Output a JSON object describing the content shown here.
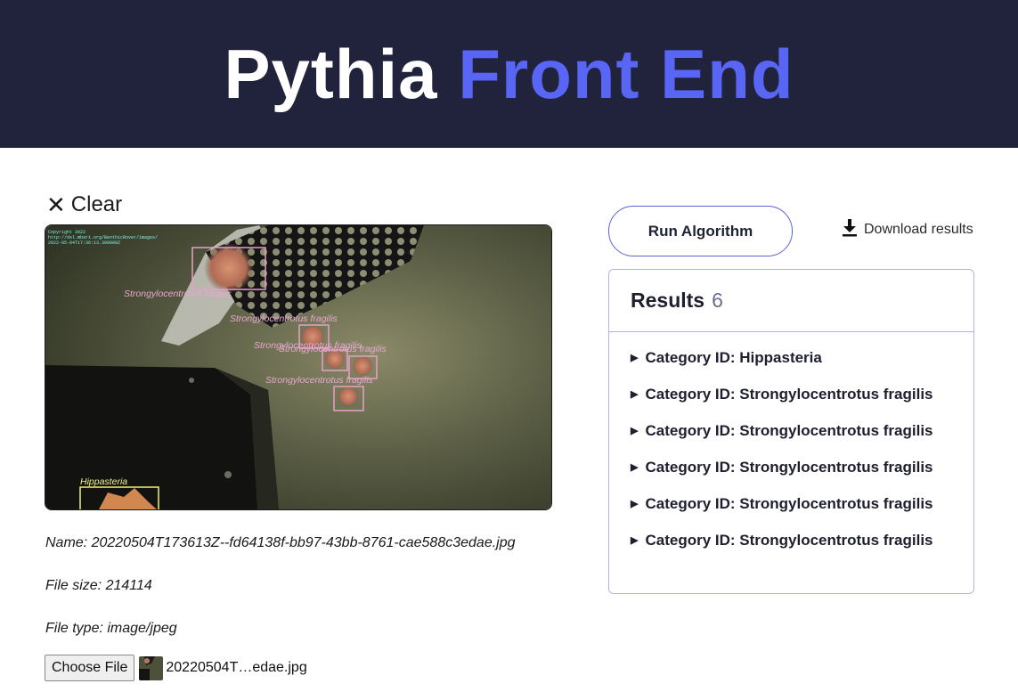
{
  "header": {
    "title_part1": "Pythia",
    "title_part2": "Front End"
  },
  "clear_button": {
    "label": "Clear"
  },
  "image": {
    "labels": [
      "Strongylocentrotus fragilis",
      "Strongylocentrotus fragilis",
      "Strongylocentrotus fragilis",
      "Strongylocentrotus fragilis",
      "Strongylocentrotus fragilis",
      "Hippasteria"
    ]
  },
  "file_info": {
    "name_line": "Name: 20220504T173613Z--fd64138f-bb97-43bb-8761-cae588c3edae.jpg",
    "size_line": "File size: 214114",
    "type_line": "File type: image/jpeg"
  },
  "file_input": {
    "button_label": "Choose File",
    "selected_file": "20220504T…edae.jpg"
  },
  "actions": {
    "run_label": "Run Algorithm",
    "download_label": "Download results"
  },
  "results": {
    "title": "Results",
    "count": "6",
    "items": [
      {
        "label": "Category ID: Hippasteria"
      },
      {
        "label": "Category ID: Strongylocentrotus fragilis"
      },
      {
        "label": "Category ID: Strongylocentrotus fragilis"
      },
      {
        "label": "Category ID: Strongylocentrotus fragilis"
      },
      {
        "label": "Category ID: Strongylocentrotus fragilis"
      },
      {
        "label": "Category ID: Strongylocentrotus fragilis"
      }
    ]
  },
  "colors": {
    "header_bg": "#21233c",
    "accent": "#5965f5",
    "urchin_box": "#e8a0c8",
    "star_box": "#f2f27a"
  },
  "icons": {
    "clear": "close-icon",
    "download": "download-icon",
    "expand": "triangle-right-icon"
  }
}
